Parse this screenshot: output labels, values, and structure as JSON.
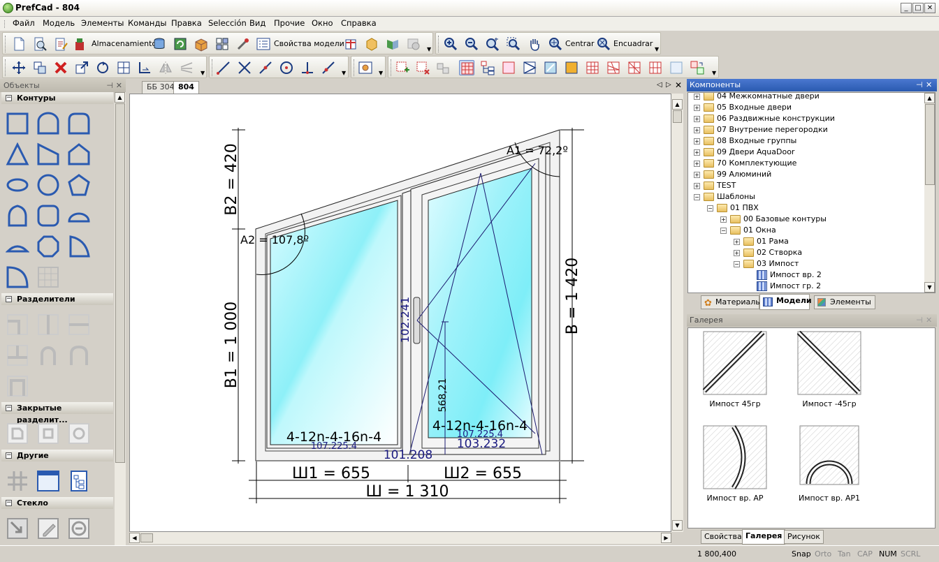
{
  "window": {
    "title": "PrefCad - 804",
    "min": "_",
    "max": "□",
    "close": "✕"
  },
  "menu": [
    "Файл",
    "Модель",
    "Элементы",
    "Команды",
    "Правка",
    "Selección",
    "Вид",
    "Прочие",
    "Окно",
    "Справка"
  ],
  "toolbar1": {
    "storage_label": "Almacenamiento",
    "model_props_label": "Свойства модели",
    "center_label": "Centrar",
    "fit_label": "Encuadrar"
  },
  "left_panel": {
    "title": "Объекты",
    "sections": {
      "contours": "Контуры",
      "dividers": "Разделители",
      "closed_dividers": "Закрытые разделит...",
      "other": "Другие",
      "glass": "Стекло"
    }
  },
  "doc_tabs": [
    "ББ 304",
    "804"
  ],
  "drawing": {
    "angle_a1": "A1 = 72,2º",
    "angle_a2": "A2 = 107,8º",
    "dim_b2": "B2 = 420",
    "dim_b1": "B1 = 1 000",
    "dim_b": "B = 1 420",
    "dim_w1": "Ш1 = 655",
    "dim_w2": "Ш2 = 655",
    "dim_w": "Ш = 1 310",
    "glass_left": "4-12n-4-16n-4",
    "glass_right": "4-12n-4-16n-4",
    "left_sub": "107.225.4",
    "right_sub": "107.225.4",
    "center_bottom": "101.208",
    "right_bottom": "103.232",
    "impost_label": "102.241",
    "sash_height": "568,21"
  },
  "components": {
    "title": "Компоненты",
    "tree": [
      {
        "label": "04 Межкомнатные двери",
        "level": 0,
        "exp": "+",
        "icon": "folder"
      },
      {
        "label": "05 Входные двери",
        "level": 0,
        "exp": "+",
        "icon": "folder"
      },
      {
        "label": "06 Раздвижные конструкции",
        "level": 0,
        "exp": "+",
        "icon": "folder"
      },
      {
        "label": "07 Внутрение перегородки",
        "level": 0,
        "exp": "+",
        "icon": "folder"
      },
      {
        "label": "08 Входные группы",
        "level": 0,
        "exp": "+",
        "icon": "folder"
      },
      {
        "label": "09 Двери AquaDoor",
        "level": 0,
        "exp": "+",
        "icon": "folder"
      },
      {
        "label": "70 Комплектующие",
        "level": 0,
        "exp": "+",
        "icon": "folder"
      },
      {
        "label": "99 Алюминий",
        "level": 0,
        "exp": "+",
        "icon": "folder"
      },
      {
        "label": "TEST",
        "level": 0,
        "exp": "+",
        "icon": "folder"
      },
      {
        "label": "Шаблоны",
        "level": 0,
        "exp": "−",
        "icon": "folder"
      },
      {
        "label": "01 ПВХ",
        "level": 1,
        "exp": "−",
        "icon": "folder"
      },
      {
        "label": "00 Базовые контуры",
        "level": 2,
        "exp": "+",
        "icon": "folder"
      },
      {
        "label": "01 Окна",
        "level": 2,
        "exp": "−",
        "icon": "folder"
      },
      {
        "label": "01 Рама",
        "level": 3,
        "exp": "+",
        "icon": "folder"
      },
      {
        "label": "02 Створка",
        "level": 3,
        "exp": "+",
        "icon": "folder"
      },
      {
        "label": "03 Импост",
        "level": 3,
        "exp": "−",
        "icon": "folder"
      },
      {
        "label": "Импост вр. 2",
        "level": 4,
        "exp": "",
        "icon": "grid"
      },
      {
        "label": "Импост гр. 2",
        "level": 4,
        "exp": "",
        "icon": "grid"
      }
    ],
    "tabs": [
      "Материалы",
      "Модели",
      "Элементы"
    ]
  },
  "gallery": {
    "title": "Галерея",
    "items": [
      "Импост 45гр",
      "Импост -45гр",
      "Импост вр. АР",
      "Импост вр. АР1"
    ],
    "tabs": [
      "Свойства",
      "Галерея",
      "Рисунок"
    ]
  },
  "status": {
    "coords": "1 800,400",
    "snap": "Snap",
    "orto": "Orto",
    "tan": "Tan",
    "cap": "CAP",
    "num": "NUM",
    "scrl": "SCRL"
  }
}
